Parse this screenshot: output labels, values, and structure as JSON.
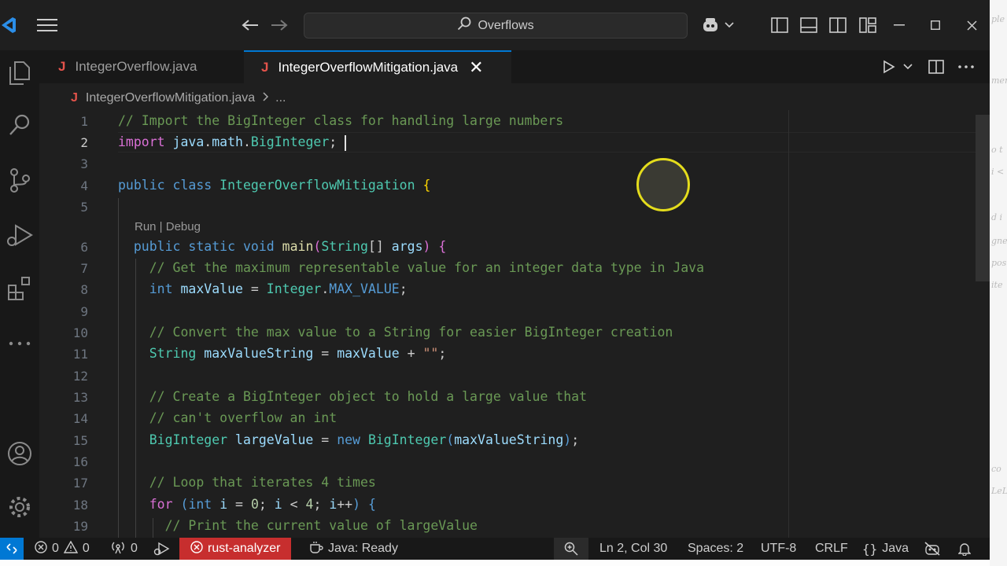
{
  "titlebar": {
    "search_text": "Overflows"
  },
  "tabs": [
    {
      "icon": "J",
      "label": "IntegerOverflow.java"
    },
    {
      "icon": "J",
      "label": "IntegerOverflowMitigation.java",
      "close": "✕"
    }
  ],
  "breadcrumb": {
    "icon": "J",
    "file": "IntegerOverflowMitigation.java",
    "more": "..."
  },
  "editor": {
    "codelens": "Run | Debug",
    "lines": [
      "1",
      "2",
      "3",
      "4",
      "5",
      "6",
      "7",
      "8",
      "9",
      "10",
      "11",
      "12",
      "13",
      "14",
      "15",
      "16",
      "17",
      "18",
      "19"
    ]
  },
  "status": {
    "errors": "0",
    "warnings": "0",
    "ports": "0",
    "rust": "rust-analyzer",
    "java": "Java: Ready",
    "position": "Ln 2, Col 30",
    "spaces": "Spaces: 2",
    "encoding": "UTF-8",
    "eol": "CRLF",
    "language": "Java"
  },
  "colors": {
    "accent": "#0078d4",
    "error_badge": "#c72e2e",
    "pointer": "#e4dc1c"
  }
}
